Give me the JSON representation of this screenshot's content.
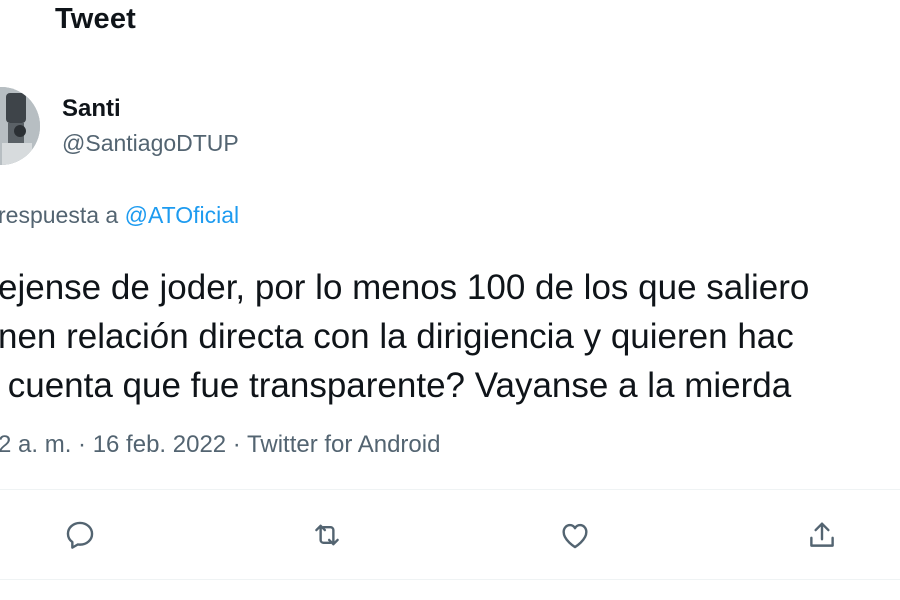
{
  "header": {
    "title": "Tweet"
  },
  "author": {
    "name": "Santi",
    "handle": "@SantiagoDTUP"
  },
  "reply": {
    "prefix": "respuesta a",
    "target": "@ATOficial"
  },
  "tweet": {
    "lines": [
      "ejense de joder, por lo menos 100 de los que saliero",
      "nen relación directa con la dirigiencia y quieren hac",
      " cuenta que fue transparente? Vayanse a la mierda"
    ],
    "meta": "2 a. m. · 16 feb. 2022 · Twitter for Android"
  },
  "actions": [
    {
      "name": "reply",
      "icon": "reply-icon"
    },
    {
      "name": "retweet",
      "icon": "retweet-icon"
    },
    {
      "name": "like",
      "icon": "heart-icon"
    },
    {
      "name": "share",
      "icon": "share-icon"
    }
  ],
  "colors": {
    "text": "#0f1419",
    "secondary": "#536471",
    "link": "#1d9bf0",
    "divider": "#eff3f4"
  }
}
